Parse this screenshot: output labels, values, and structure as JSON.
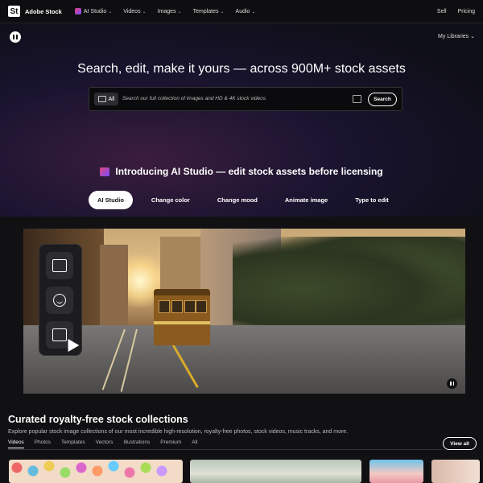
{
  "nav": {
    "brand": "Adobe Stock",
    "logo_text": "St",
    "items": [
      {
        "label": "AI Studio",
        "badge": true
      },
      {
        "label": "Videos"
      },
      {
        "label": "Images"
      },
      {
        "label": "Templates"
      },
      {
        "label": "Audio"
      }
    ],
    "right": [
      "Sell",
      "Pricing"
    ]
  },
  "hero": {
    "my_libraries": "My Libraries",
    "title": "Search, edit, make it yours — across 900M+ stock assets",
    "search": {
      "filter_label": "All",
      "placeholder": "Search our full collection of images and HD & 4K stock videos",
      "button_label": "Search"
    }
  },
  "intro": {
    "title": "Introducing AI Studio — edit stock assets before licensing",
    "tabs": [
      "AI Studio",
      "Change color",
      "Change mood",
      "Animate image",
      "Type to edit"
    ],
    "active_tab": "AI Studio"
  },
  "curated": {
    "title": "Curated royalty-free stock collections",
    "subtitle": "Explore popular stock image collections of our most incredible high-resolution, royalty-free photos, stock videos, music tracks, and more.",
    "tabs": [
      "Videos",
      "Photos",
      "Templates",
      "Vectors",
      "Illustrations",
      "Premium",
      "All"
    ],
    "active_tab": "Videos",
    "view_all": "View all"
  },
  "colors": {
    "accent": "#e0457b",
    "background": "#111114"
  }
}
